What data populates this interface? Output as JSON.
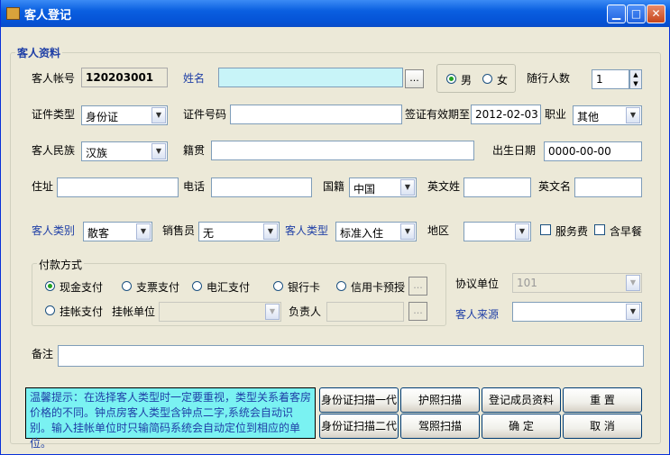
{
  "window": {
    "title": "客人登记"
  },
  "group_info": {
    "title": "客人资料"
  },
  "fields": {
    "account_label": "客人帐号",
    "account_value": "120203001",
    "name_label": "姓名",
    "name_value": "",
    "gender_male": "男",
    "gender_female": "女",
    "companions_label": "随行人数",
    "companions_value": "1",
    "idtype_label": "证件类型",
    "idtype_value": "身份证",
    "idno_label": "证件号码",
    "idno_value": "",
    "visa_label": "签证有效期至",
    "visa_value": "2012-02-03",
    "job_label": "职业",
    "job_value": "其他",
    "ethnic_label": "客人民族",
    "ethnic_value": "汉族",
    "origin_label": "籍贯",
    "origin_value": "",
    "birth_label": "出生日期",
    "birth_value": "0000-00-00",
    "address_label": "住址",
    "phone_label": "电话",
    "nation_label": "国籍",
    "nation_value": "中国",
    "surname_en_label": "英文姓",
    "givenname_en_label": "英文名",
    "category_label": "客人类别",
    "category_value": "散客",
    "sales_label": "销售员",
    "sales_value": "无",
    "type_label": "客人类型",
    "type_value": "标准入住",
    "region_label": "地区",
    "region_value": "",
    "service_fee_label": "服务费",
    "breakfast_label": "含早餐",
    "agreement_label": "协议单位",
    "agreement_value": "101",
    "source_label": "客人来源",
    "source_value": "",
    "remark_label": "备注"
  },
  "payment": {
    "title": "付款方式",
    "cash": "现金支付",
    "cheque": "支票支付",
    "wire": "电汇支付",
    "bankcard": "银行卡",
    "creditcard": "信用卡预授",
    "charge": "挂帐支付",
    "charge_unit_label": "挂帐单位",
    "manager_label": "负责人"
  },
  "tip": "温馨提示：在选择客人类型时一定要重视，类型关系着客房价格的不同。钟点房客人类型含钟点二字,系统会自动识别。输入挂帐单位时只输简码系统会自动定位到相应的单位。",
  "buttons": {
    "id_scan_1": "身份证扫描一代",
    "passport_scan": "护照扫描",
    "register_members": "登记成员资料",
    "reset": "重 置",
    "id_scan_2": "身份证扫描二代",
    "license_scan": "驾照扫描",
    "ok": "确 定",
    "cancel": "取 消"
  },
  "dots": "...",
  "colors": {
    "title_bar": "#0a5fe0",
    "name_field": "#c8f4f8",
    "tip_background": "#7af2f2"
  }
}
